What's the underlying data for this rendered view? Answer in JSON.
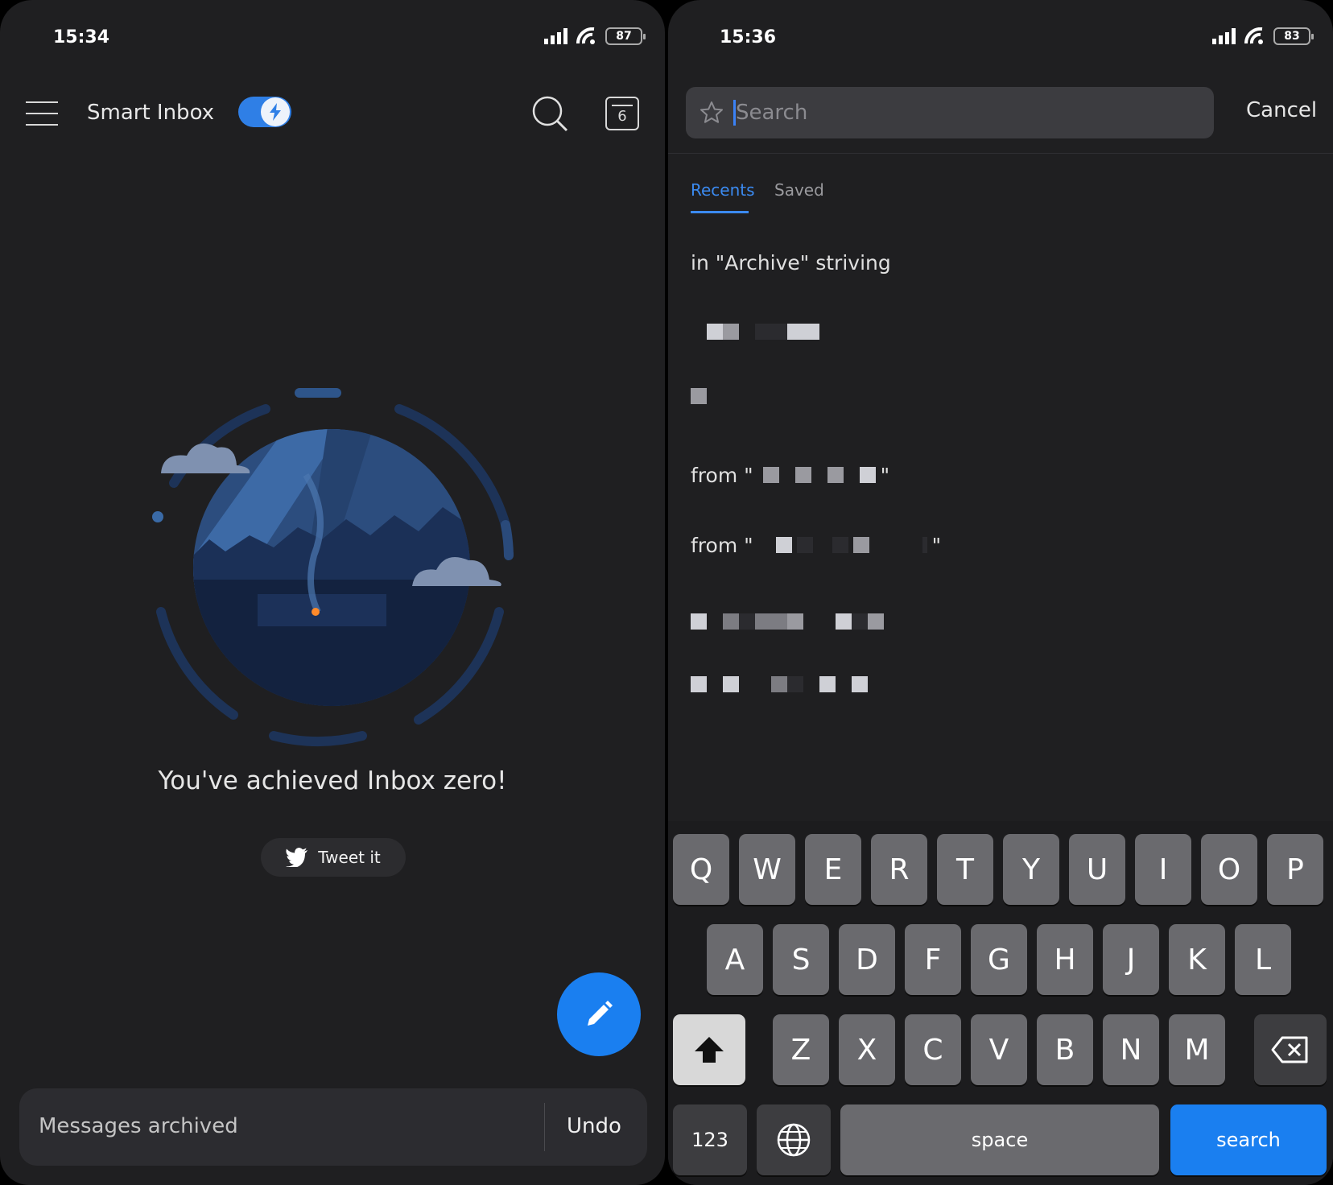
{
  "left": {
    "status": {
      "time": "15:34",
      "battery": "87"
    },
    "header": {
      "title": "Smart Inbox",
      "calendar_day": "6"
    },
    "empty_state": {
      "message": "You've achieved Inbox zero!",
      "tweet_label": "Tweet it"
    },
    "snackbar": {
      "text": "Messages archived",
      "action": "Undo"
    },
    "accent_color": "#1a7ff0"
  },
  "right": {
    "status": {
      "time": "15:36",
      "battery": "83"
    },
    "search": {
      "placeholder": "Search",
      "cancel_label": "Cancel"
    },
    "tabs": [
      {
        "label": "Recents",
        "active": true
      },
      {
        "label": "Saved",
        "active": false
      }
    ],
    "recents": [
      {
        "text": "in \"Archive\" striving"
      },
      {
        "prefix": ""
      },
      {
        "prefix": ""
      },
      {
        "prefix": "from \"",
        "suffix": "\""
      },
      {
        "prefix": "from \"",
        "suffix": "\""
      },
      {
        "prefix": ""
      },
      {
        "prefix": ""
      }
    ],
    "keyboard": {
      "row1": [
        "Q",
        "W",
        "E",
        "R",
        "T",
        "Y",
        "U",
        "I",
        "O",
        "P"
      ],
      "row2": [
        "A",
        "S",
        "D",
        "F",
        "G",
        "H",
        "J",
        "K",
        "L"
      ],
      "row3": [
        "Z",
        "X",
        "C",
        "V",
        "B",
        "N",
        "M"
      ],
      "numbers_label": "123",
      "space_label": "space",
      "action_label": "search"
    }
  }
}
